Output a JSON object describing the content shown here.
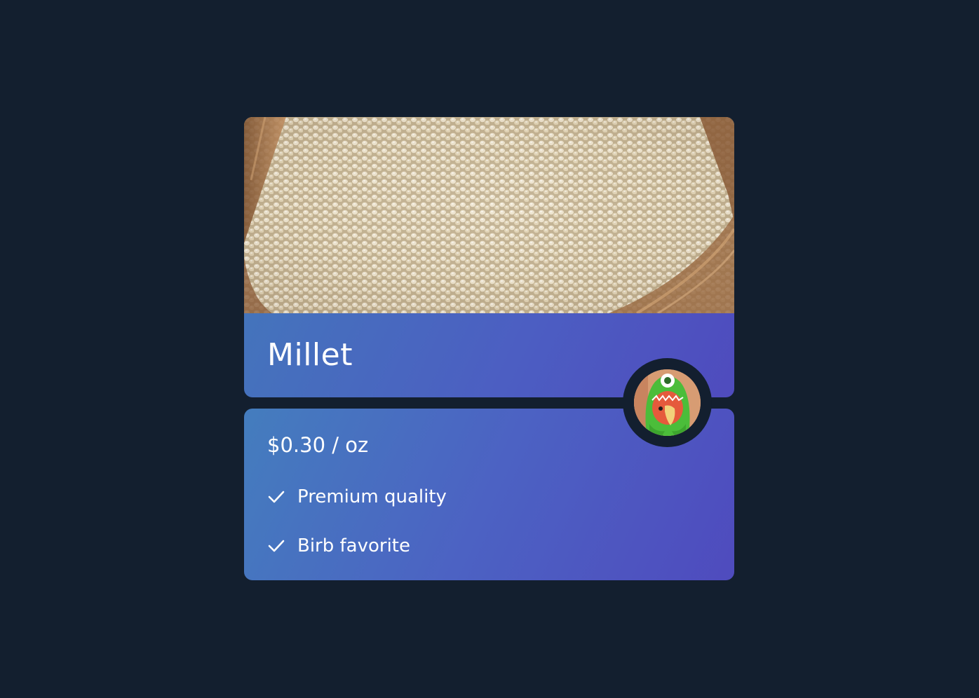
{
  "product": {
    "name": "Millet",
    "price": "$0.30 / oz",
    "features": [
      {
        "label": "Premium quality",
        "icon": "check-icon"
      },
      {
        "label": "Birb favorite",
        "icon": "check-icon"
      }
    ],
    "image_icon": "millet-basket-photo",
    "avatar_icon": "bird-in-costume-avatar"
  },
  "colors": {
    "background": "#131f2f",
    "gradient_start": "#4474bc",
    "gradient_end": "#4f4bbe",
    "text": "#ffffff"
  }
}
